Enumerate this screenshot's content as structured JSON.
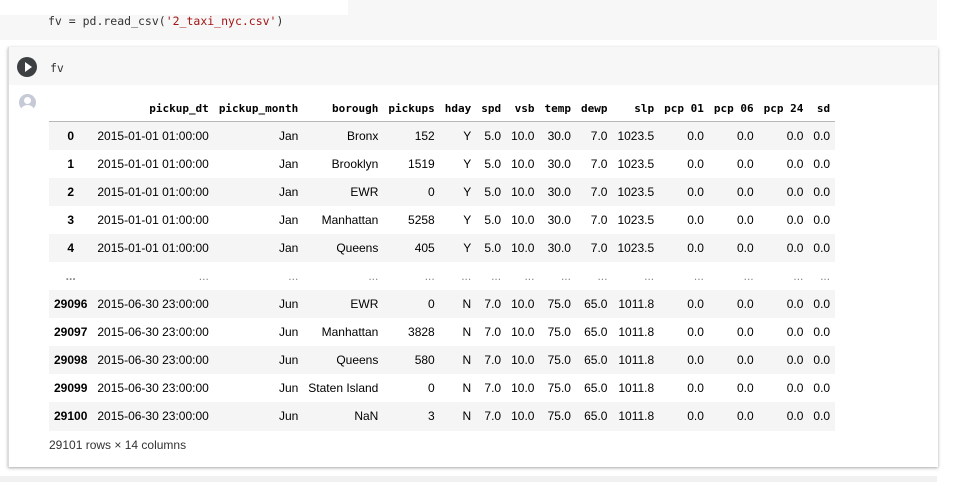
{
  "previous_cell": {
    "code_prefix": "fv = pd.read_csv(",
    "code_string": "'2_taxi_nyc.csv'",
    "code_suffix": ")"
  },
  "cell": {
    "code": "fv",
    "run_icon": "play-icon",
    "output_icon": "person-icon"
  },
  "dataframe": {
    "columns": [
      "",
      "pickup_dt",
      "pickup_month",
      "borough",
      "pickups",
      "hday",
      "spd",
      "vsb",
      "temp",
      "dewp",
      "slp",
      "pcp 01",
      "pcp 06",
      "pcp 24",
      "sd"
    ],
    "rows": [
      [
        "0",
        "2015-01-01 01:00:00",
        "Jan",
        "Bronx",
        "152",
        "Y",
        "5.0",
        "10.0",
        "30.0",
        "7.0",
        "1023.5",
        "0.0",
        "0.0",
        "0.0",
        "0.0"
      ],
      [
        "1",
        "2015-01-01 01:00:00",
        "Jan",
        "Brooklyn",
        "1519",
        "Y",
        "5.0",
        "10.0",
        "30.0",
        "7.0",
        "1023.5",
        "0.0",
        "0.0",
        "0.0",
        "0.0"
      ],
      [
        "2",
        "2015-01-01 01:00:00",
        "Jan",
        "EWR",
        "0",
        "Y",
        "5.0",
        "10.0",
        "30.0",
        "7.0",
        "1023.5",
        "0.0",
        "0.0",
        "0.0",
        "0.0"
      ],
      [
        "3",
        "2015-01-01 01:00:00",
        "Jan",
        "Manhattan",
        "5258",
        "Y",
        "5.0",
        "10.0",
        "30.0",
        "7.0",
        "1023.5",
        "0.0",
        "0.0",
        "0.0",
        "0.0"
      ],
      [
        "4",
        "2015-01-01 01:00:00",
        "Jan",
        "Queens",
        "405",
        "Y",
        "5.0",
        "10.0",
        "30.0",
        "7.0",
        "1023.5",
        "0.0",
        "0.0",
        "0.0",
        "0.0"
      ],
      [
        "...",
        "...",
        "...",
        "...",
        "...",
        "...",
        "...",
        "...",
        "...",
        "...",
        "...",
        "...",
        "...",
        "...",
        "..."
      ],
      [
        "29096",
        "2015-06-30 23:00:00",
        "Jun",
        "EWR",
        "0",
        "N",
        "7.0",
        "10.0",
        "75.0",
        "65.0",
        "1011.8",
        "0.0",
        "0.0",
        "0.0",
        "0.0"
      ],
      [
        "29097",
        "2015-06-30 23:00:00",
        "Jun",
        "Manhattan",
        "3828",
        "N",
        "7.0",
        "10.0",
        "75.0",
        "65.0",
        "1011.8",
        "0.0",
        "0.0",
        "0.0",
        "0.0"
      ],
      [
        "29098",
        "2015-06-30 23:00:00",
        "Jun",
        "Queens",
        "580",
        "N",
        "7.0",
        "10.0",
        "75.0",
        "65.0",
        "1011.8",
        "0.0",
        "0.0",
        "0.0",
        "0.0"
      ],
      [
        "29099",
        "2015-06-30 23:00:00",
        "Jun",
        "Staten Island",
        "0",
        "N",
        "7.0",
        "10.0",
        "75.0",
        "65.0",
        "1011.8",
        "0.0",
        "0.0",
        "0.0",
        "0.0"
      ],
      [
        "29100",
        "2015-06-30 23:00:00",
        "Jun",
        "NaN",
        "3",
        "N",
        "7.0",
        "10.0",
        "75.0",
        "65.0",
        "1011.8",
        "0.0",
        "0.0",
        "0.0",
        "0.0"
      ]
    ],
    "shape": "29101 rows × 14 columns"
  }
}
